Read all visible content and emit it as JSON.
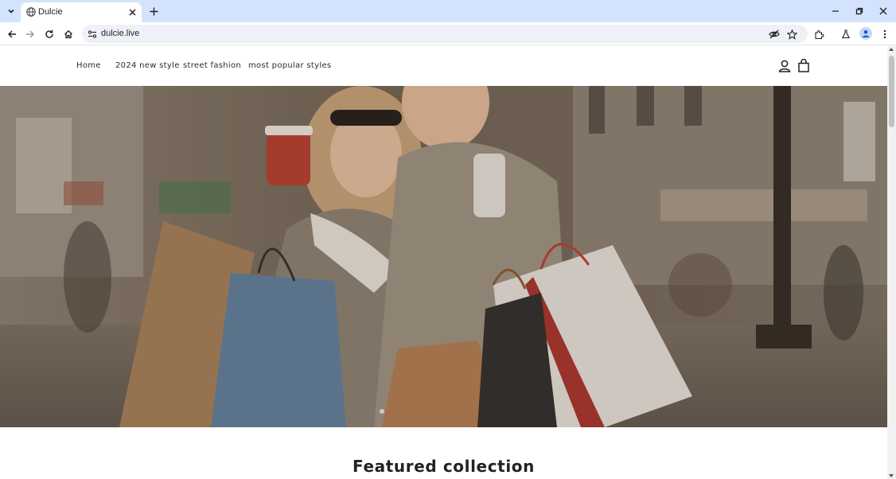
{
  "browser": {
    "tab_title": "Dulcie",
    "url": "dulcie.live",
    "icons": [
      "tab-list-icon",
      "globe-icon",
      "close-icon",
      "plus-icon",
      "minimize-icon",
      "restore-icon",
      "close-window-icon",
      "back-icon",
      "forward-icon",
      "reload-icon",
      "home-icon",
      "site-info-icon",
      "eye-off-icon",
      "star-icon",
      "extensions-icon",
      "labs-icon",
      "profile-icon",
      "more-icon"
    ]
  },
  "nav": {
    "items": [
      {
        "label": "Home"
      },
      {
        "label": "2024 new style"
      },
      {
        "label": "street fashion"
      },
      {
        "label": "most popular styles"
      }
    ]
  },
  "hero": {
    "image": "two-women-shopping-bags-photo"
  },
  "featured": {
    "title": "Featured collection"
  },
  "colors": {
    "tabbar": "#d3e3fd",
    "omnibox": "#eef1f8",
    "text": "#2b2b2b"
  }
}
